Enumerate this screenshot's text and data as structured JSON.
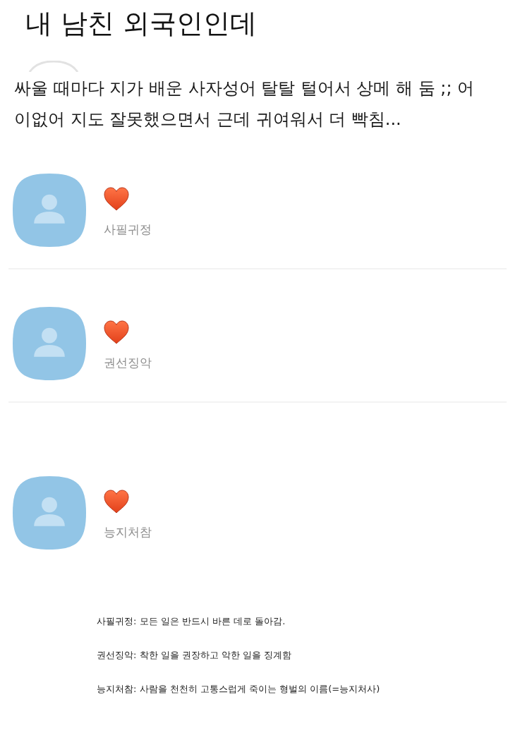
{
  "title": "내 남친 외국인인데",
  "post": {
    "text": "싸울 때마다 지가 배운 사자성어 탈탈 털어서 상메 해 둠 ;; 어\n이없어 지도 잘못했으면서 근데 귀여워서 더 빡침..."
  },
  "profiles": [
    {
      "status_message": "사필귀정"
    },
    {
      "status_message": "권선징악"
    },
    {
      "status_message": "능지처참"
    }
  ],
  "notes": [
    "사필귀정: 모든 일은 반드시 바른 데로 돌아감.",
    "권선징악: 착한 일을 권장하고 악한 일을 징계함",
    "능지처참: 사람을 천천히 고통스럽게 죽이는 형벌의 이름(=능지처사)"
  ]
}
